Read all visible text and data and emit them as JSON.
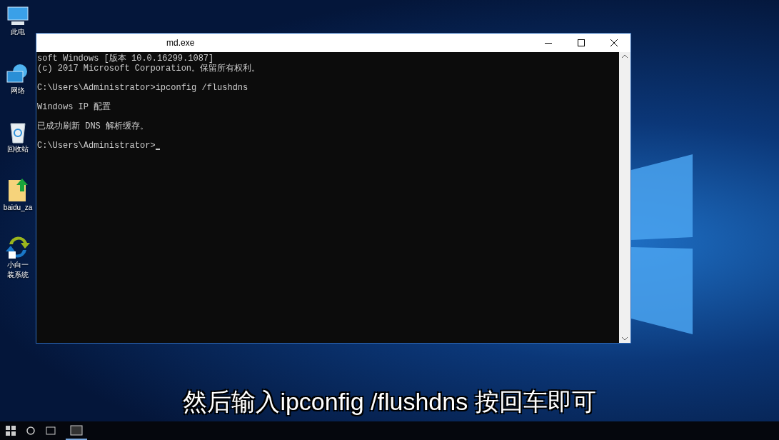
{
  "desktop": {
    "icons": [
      {
        "kind": "computer",
        "label": "此电"
      },
      {
        "kind": "network",
        "label": "网络"
      },
      {
        "kind": "recycle",
        "label": "回收站"
      },
      {
        "kind": "file",
        "label": "baidu_za"
      },
      {
        "kind": "app",
        "label": "小白一",
        "label_2": "装系统"
      }
    ]
  },
  "window": {
    "title": "md.exe",
    "blocks": [
      [
        "soft Windows [版本 10.0.16299.1087]",
        "(c) 2017 Microsoft Corporation。保留所有权利。"
      ],
      [
        "C:\\Users\\Administrator>ipconfig /flushdns"
      ],
      [
        "Windows IP 配置"
      ],
      [
        "已成功刷新 DNS 解析缓存。"
      ]
    ],
    "prompt": "C:\\Users\\Administrator>"
  },
  "subtitle": "然后输入ipconfig /flushdns 按回车即可"
}
